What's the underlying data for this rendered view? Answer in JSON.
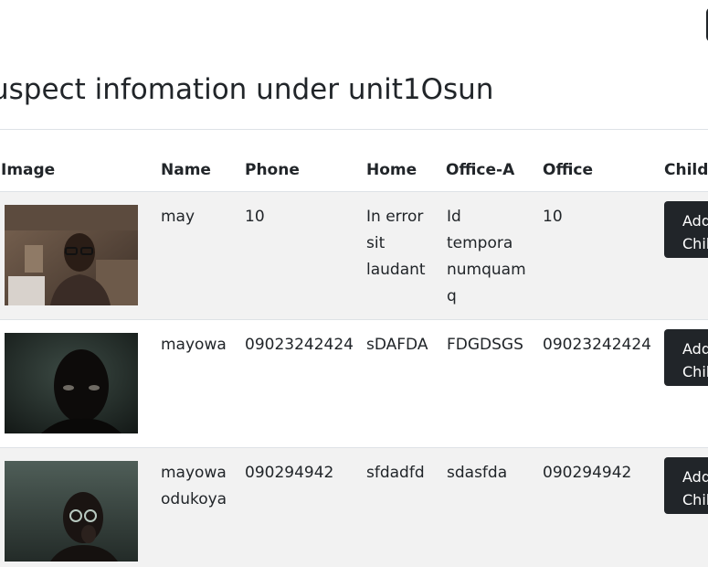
{
  "page": {
    "title": "uspect infomation under unit1Osun"
  },
  "table": {
    "headers": [
      "Image",
      "Name",
      "Phone",
      "Home",
      "Office-A",
      "Office",
      "Childe"
    ],
    "rows": [
      {
        "name": "may",
        "phone": "10",
        "home": "In error\nsit\nlaudant",
        "office_a": "Id\ntempora\nnumquam\nq",
        "office": "10",
        "action": "Add\nChil"
      },
      {
        "name": "mayowa",
        "phone": "09023242424",
        "home": "sDAFDA",
        "office_a": "FDGDSGS",
        "office": "09023242424",
        "action": "Add\nChil"
      },
      {
        "name": "mayowa\nodukoya",
        "phone": "090294942",
        "home": "sfdadfd",
        "office_a": "sdasfda",
        "office": "090294942",
        "action": "Add\nChil"
      }
    ]
  },
  "icons": {
    "suspect_photo": "suspect-photo"
  },
  "colors": {
    "button_dark": "#212529",
    "row_stripe": "#f2f2f2"
  }
}
